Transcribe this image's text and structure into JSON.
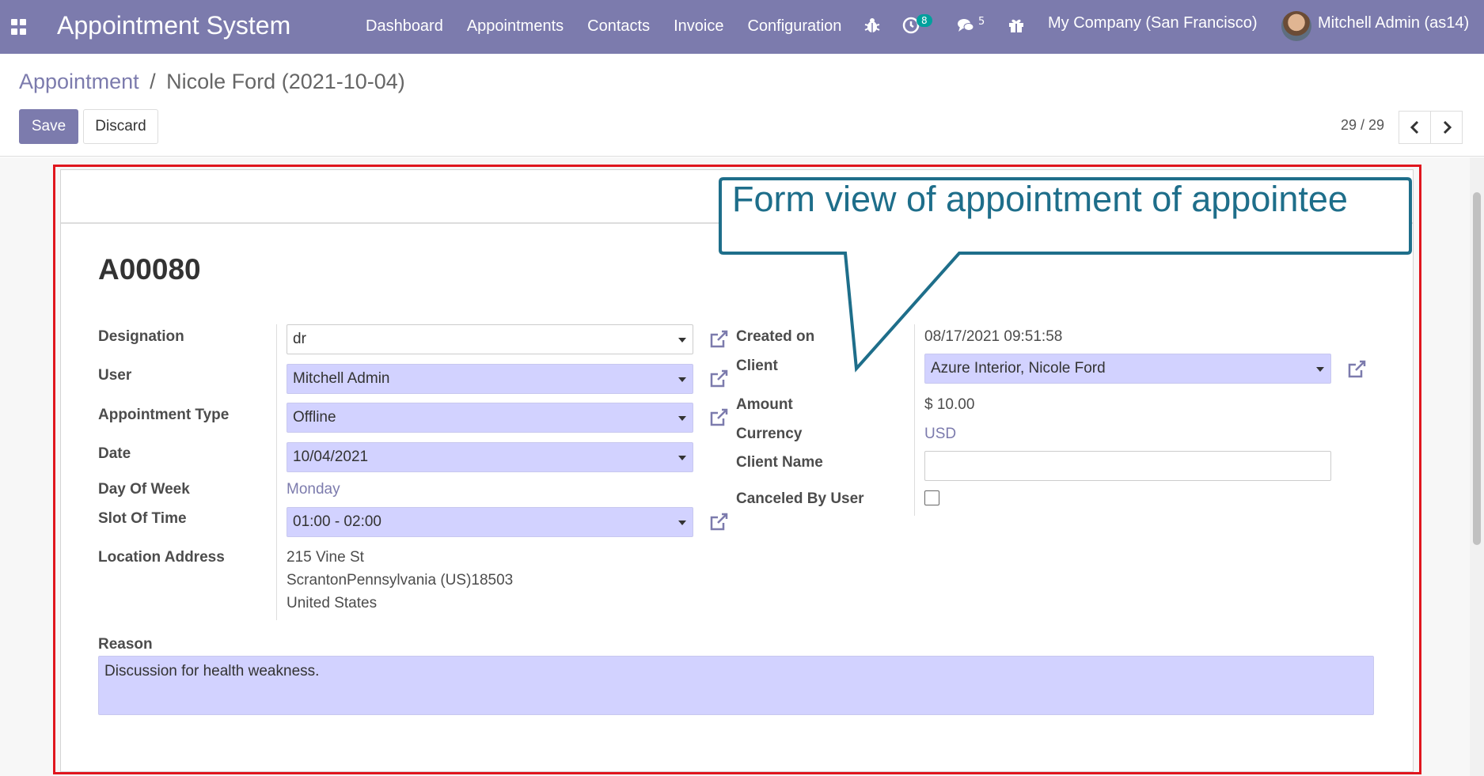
{
  "navbar": {
    "brand": "Appointment System",
    "menu": [
      "Dashboard",
      "Appointments",
      "Contacts",
      "Invoice",
      "Configuration"
    ],
    "activity_count": "8",
    "messages_count": "5",
    "company": "My Company (San Francisco)",
    "user": "Mitchell Admin (as14)",
    "icons": [
      "apps-icon",
      "bug-icon",
      "clock-icon",
      "chat-icon",
      "gift-icon"
    ]
  },
  "breadcrumb": {
    "parent": "Appointment",
    "separator": "/",
    "current": "Nicole Ford (2021-10-04)"
  },
  "toolbar": {
    "save_label": "Save",
    "discard_label": "Discard"
  },
  "pager": {
    "value": "29 / 29"
  },
  "record": {
    "name": "A00080",
    "left": {
      "designation": {
        "label": "Designation",
        "value": "dr"
      },
      "user": {
        "label": "User",
        "value": "Mitchell Admin"
      },
      "appointment_type": {
        "label": "Appointment Type",
        "value": "Offline"
      },
      "date": {
        "label": "Date",
        "value": "10/04/2021"
      },
      "day_of_week": {
        "label": "Day Of Week",
        "value": "Monday"
      },
      "slot": {
        "label": "Slot Of Time",
        "value": "01:00 - 02:00"
      },
      "location": {
        "label": "Location Address",
        "line1": "215 Vine St",
        "line2": "ScrantonPennsylvania (US)18503",
        "line3": "United States"
      }
    },
    "right": {
      "created_on": {
        "label": "Created on",
        "value": "08/17/2021 09:51:58"
      },
      "client": {
        "label": "Client",
        "value": "Azure Interior, Nicole Ford"
      },
      "amount": {
        "label": "Amount",
        "value": "$ 10.00"
      },
      "currency": {
        "label": "Currency",
        "value": "USD"
      },
      "client_name": {
        "label": "Client Name",
        "value": ""
      },
      "canceled": {
        "label": "Canceled By User",
        "checked": false
      }
    },
    "reason": {
      "label": "Reason",
      "value": "Discussion for health weakness."
    }
  },
  "annotation": {
    "text": "Form view of appointment of appointee",
    "color": "#1e6e8a",
    "highlight_color": "#e0161e"
  },
  "colors": {
    "primary": "#7c7bad",
    "required_bg": "#d2d2ff",
    "badge": "#00a09d"
  }
}
